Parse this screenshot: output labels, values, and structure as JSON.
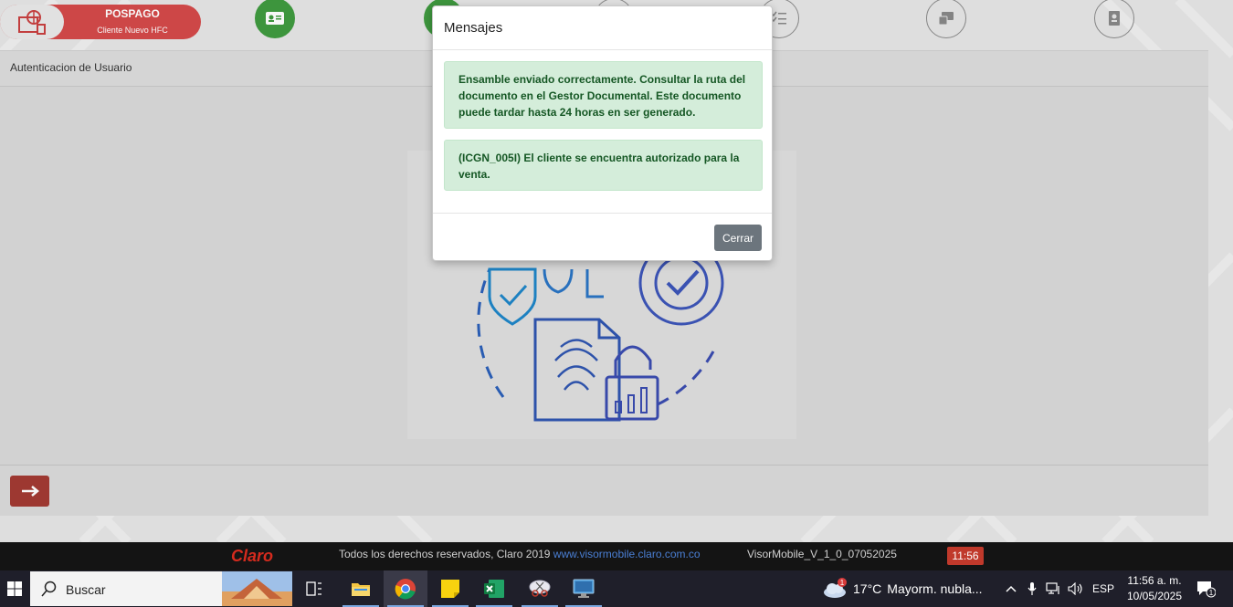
{
  "header": {
    "plan_title": "POSPAGO",
    "plan_subtitle": "Cliente Nuevo HFC"
  },
  "card": {
    "title": "Autenticacion de Usuario"
  },
  "modal": {
    "title": "Mensajes",
    "alerts": [
      "Ensamble enviado correctamente. Consultar la ruta del documento en el Gestor Documental. Este documento puede tardar hasta 24 horas en ser generado.",
      "(ICGN_005I) El cliente se encuentra autorizado para la venta."
    ],
    "close_label": "Cerrar"
  },
  "footer": {
    "logo_text": "Claro",
    "rights_text": "Todos los derechos reservados, Claro 2019 ",
    "link_text": "www.visormobile.claro.com.co",
    "version": "VisorMobile_V_1_0_07052025",
    "time": "11:56"
  },
  "taskbar": {
    "search_placeholder": "Buscar",
    "weather_temp": "17°C",
    "weather_desc": "Mayorm. nubla...",
    "weather_badge": "1",
    "language": "ESP",
    "clock_time": "11:56 a. m.",
    "clock_date": "10/05/2025",
    "notification_count": "1"
  },
  "colors": {
    "brand_red": "#d44a4a",
    "success_bg": "#d4edda",
    "success_text": "#155724",
    "step_active": "#3f9a3f"
  }
}
